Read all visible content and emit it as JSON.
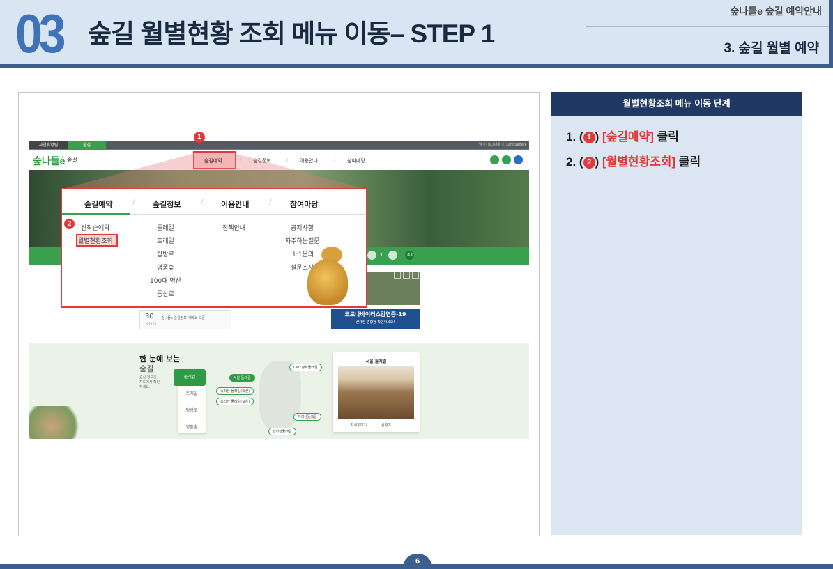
{
  "header": {
    "number": "03",
    "title": "숲길 월별현황 조회 메뉴 이동– STEP 1",
    "category": "숲나들e 숲길 예약안내",
    "subtitle": "3. 숲길 월별 예약"
  },
  "screenshot": {
    "topbar": {
      "tab1": "자연휴양림",
      "tab2": "숲길",
      "right": "님 ⓘ 로그아웃 ⓘ Language ▾"
    },
    "logo": "숲나들e",
    "logo_sub": "숲길",
    "gnb": [
      "숲길예약",
      "숲길정보",
      "이용안내",
      "참여마당"
    ],
    "badge1": "1",
    "badge2": "2",
    "dropdown": {
      "headers": [
        "숲길예약",
        "숲길정보",
        "이용안내",
        "참여마당"
      ],
      "col1": [
        "선착순예약",
        "월별현황조회"
      ],
      "col2": [
        "둘레길",
        "트레일",
        "탐방로",
        "명품숲",
        "100대 명산",
        "등산로"
      ],
      "col3": [
        "정책안내"
      ],
      "col4": [
        "공지사항",
        "자주하는질문",
        "1:1문의",
        "설문조사"
      ]
    },
    "search_control": {
      "count": "1",
      "button": "조회"
    },
    "calendar": {
      "day": "30",
      "date": "2020.11",
      "text": "숲나들e 숲길정보 서비스 오픈"
    },
    "corona_banner": "코로나바이러스감염증-19",
    "corona_sub": "산재한 종합정 확인하세요!",
    "map_section": {
      "title1": "한 눈에 보는",
      "title2": "숲길",
      "desc": "숲길 정보를 지도에서 확인하세요.",
      "menu": [
        "둘레길",
        "트레일",
        "탐방로",
        "명품숲"
      ],
      "tags": [
        "DMZ평화둘레길",
        "서울 둘레길",
        "속리산 둘레길(괴산)",
        "속리산 둘레길(보은)",
        "지리산둘레길",
        "한라산둘레길"
      ],
      "card_title": "서울 둘레길",
      "card_link1": "자세히보기",
      "card_link2": "길찾기"
    }
  },
  "panel": {
    "heading": "월별현황조회 메뉴 이동 단계",
    "step1_prefix": "1. (",
    "step1_mark": "1",
    "step1_close": ")",
    "step1_highlight": "[숲길예약]",
    "step1_suffix": "클릭",
    "step2_prefix": "2. (",
    "step2_mark": "2",
    "step2_close": ")",
    "step2_highlight": "[월별현황조회]",
    "step2_suffix": "클릭"
  },
  "page_number": "6",
  "colors": {
    "accent_blue": "#3d5f90",
    "number_blue": "#3f73b8",
    "green": "#3aa051",
    "highlight_red": "#e23a3a",
    "panel_bg": "#dce6f2",
    "panel_head": "#1f3864"
  }
}
